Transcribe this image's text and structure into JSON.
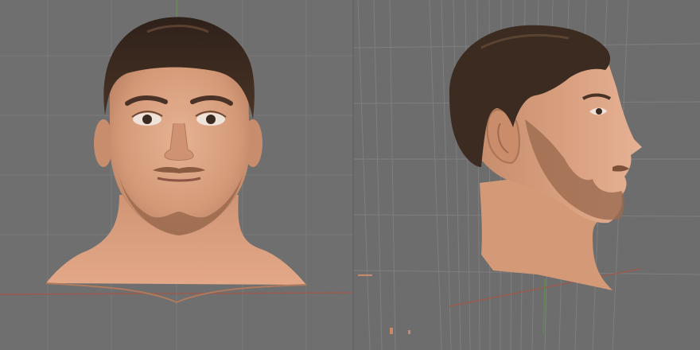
{
  "app": {
    "title": "",
    "viewports": [
      {
        "name": "front",
        "view": "front-orthographic"
      },
      {
        "name": "side",
        "view": "right-perspective"
      }
    ]
  },
  "scene": {
    "model": "head-bust",
    "colors": {
      "viewport_background": "#6f6f6f",
      "grid_line": "#7c7c7c",
      "axis_x": "#9b5a4e",
      "axis_z": "#5c8a4f",
      "skin": "#d49a78",
      "hair": "#3a2a20",
      "beard": "#9b6a4f"
    }
  }
}
